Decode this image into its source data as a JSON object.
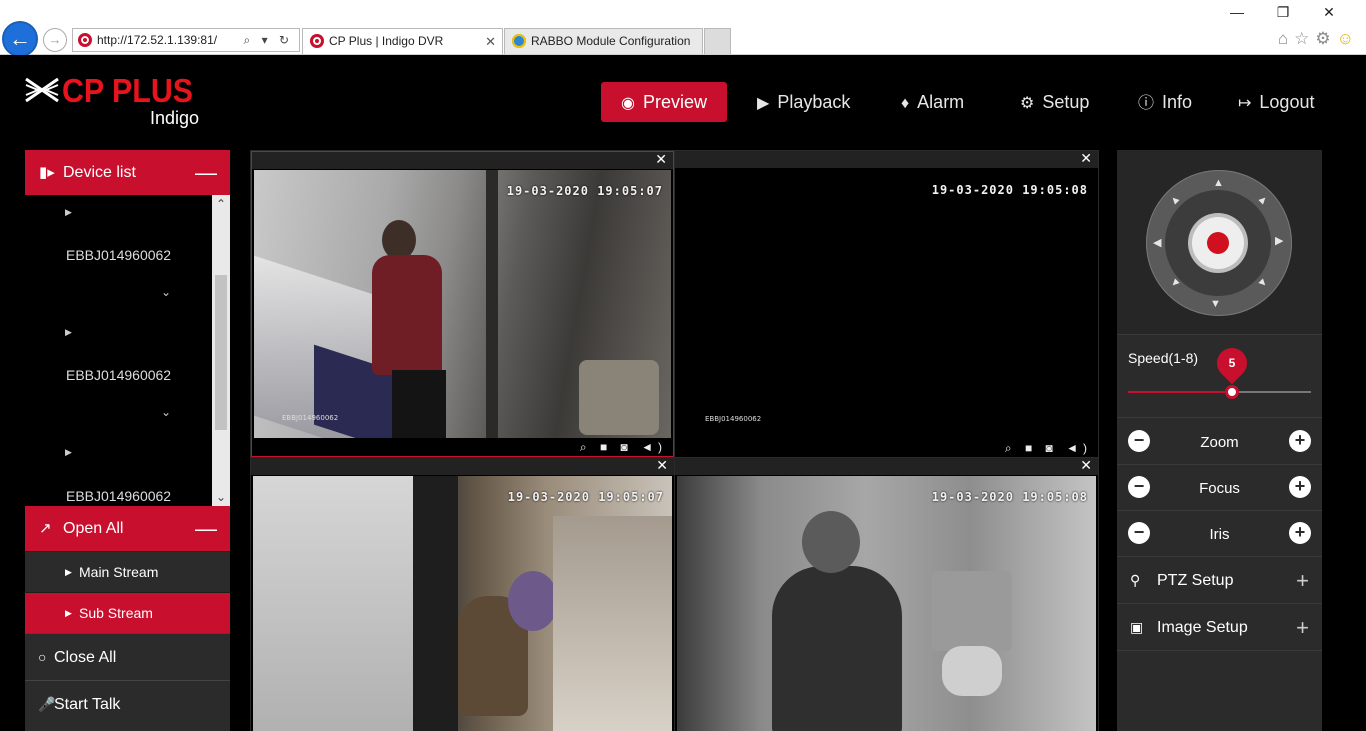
{
  "browser": {
    "address": "http://172.52.1.139:81/",
    "address_tools": "⌕ ▾ ↻",
    "tabs": [
      {
        "title": "CP Plus | Indigo DVR",
        "active": true
      },
      {
        "title": "RABBO Module Configuration",
        "active": false
      }
    ],
    "window_controls": [
      "—",
      "❐",
      "✕"
    ]
  },
  "brand": {
    "name": "CP PLUS",
    "product": "Indigo"
  },
  "nav": [
    {
      "label": "Preview",
      "icon": "eye-icon",
      "active": true
    },
    {
      "label": "Playback",
      "icon": "play-circle-icon",
      "active": false
    },
    {
      "label": "Alarm",
      "icon": "bell-icon",
      "active": false
    },
    {
      "label": "Setup",
      "icon": "gear-icon",
      "active": false
    },
    {
      "label": "Info",
      "icon": "info-icon",
      "active": false
    },
    {
      "label": "Logout",
      "icon": "logout-icon",
      "active": false
    }
  ],
  "left_panel": {
    "device_list_title": "Device list",
    "devices": [
      "EBBJ014960062",
      "EBBJ014960062",
      "EBBJ014960062"
    ],
    "open_all_title": "Open All",
    "streams": [
      {
        "label": "Main Stream",
        "selected": false
      },
      {
        "label": "Sub Stream",
        "selected": true
      }
    ],
    "close_all": "Close All",
    "start_talk": "Start Talk"
  },
  "video": {
    "cells": [
      {
        "timestamp": "19-03-2020 19:05:07",
        "device": "EBBJ014960062",
        "selected": true
      },
      {
        "timestamp": "19-03-2020 19:05:08",
        "device": "EBBJ014960062",
        "selected": false
      },
      {
        "timestamp": "19-03-2020 19:05:07",
        "device": "",
        "selected": false
      },
      {
        "timestamp": "19-03-2020 19:05:08",
        "device": "",
        "selected": false
      }
    ],
    "close_glyph": "✕",
    "cell_controls": "⌕ ■ ◙ ◄)"
  },
  "ptz": {
    "speed_label": "Speed(1-8)",
    "speed_value": 5,
    "speed_min": 1,
    "speed_max": 8,
    "adjust": [
      {
        "label": "Zoom"
      },
      {
        "label": "Focus"
      },
      {
        "label": "Iris"
      }
    ],
    "menus": [
      {
        "label": "PTZ Setup",
        "icon": "gamepad-icon"
      },
      {
        "label": "Image Setup",
        "icon": "image-file-icon"
      }
    ]
  },
  "colors": {
    "accent": "#c8102e",
    "background": "#000000",
    "panel": "#2b2b2b"
  }
}
